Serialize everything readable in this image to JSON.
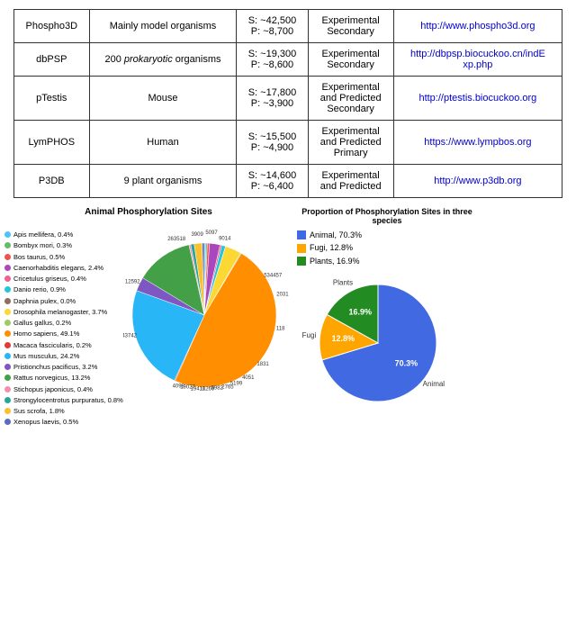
{
  "table": {
    "rows": [
      {
        "name": "Phospho3D",
        "organisms": "Mainly model organisms",
        "sites": "S: ~42,500\nP: ~8,700",
        "type": "Experimental\nSecondary",
        "url": "http://www.phospho3d.org"
      },
      {
        "name": "dbPSP",
        "organisms": "200 prokaryotic organisms",
        "organisms_italic": "prokaryotic",
        "sites": "S: ~19,300\nP: ~8,600",
        "type": "Experimental\nSecondary",
        "url": "http://dbpsp.biocuckoo.cn/indExp.php"
      },
      {
        "name": "pTestis",
        "organisms": "Mouse",
        "sites": "S: ~17,800\nP: ~3,900",
        "type": "Experimental\nand Predicted\nSecondary",
        "url": "http://ptestis.biocuckoo.org"
      },
      {
        "name": "LymPHOS",
        "organisms": "Human",
        "sites": "S: ~15,500\nP: ~4,900",
        "type": "Experimental\nand Predicted\nPrimary",
        "url": "https://www.lympbos.org"
      },
      {
        "name": "P3DB",
        "organisms": "9 plant organisms",
        "sites": "S: ~14,600\nP: ~6,400",
        "type": "Experimental\nand Predicted",
        "url": "http://www.p3db.org"
      }
    ]
  },
  "leftChart": {
    "title": "Animal Phosphorylation Sites",
    "legend": [
      {
        "label": "Apis mellifera, 0.4%",
        "color": "#1E90FF"
      },
      {
        "label": "Bombyx mori, 0.3%",
        "color": "#32CD32"
      },
      {
        "label": "Bos taurus, 0.5%",
        "color": "#FF6347"
      },
      {
        "label": "Caenorhabditis elegans, 2.4%",
        "color": "#9370DB"
      },
      {
        "label": "Cricetulus griseus, 0.4%",
        "color": "#FF1493"
      },
      {
        "label": "Danio rerio, 0.9%",
        "color": "#00CED1"
      },
      {
        "label": "Daphnia pulex, 0.0%",
        "color": "#8B4513"
      },
      {
        "label": "Drosophila melanogaster, 3.7%",
        "color": "#FFD700"
      },
      {
        "label": "Gallus gallus, 0.2%",
        "color": "#ADFF2F"
      },
      {
        "label": "Homo sapiens, 49.1%",
        "color": "#FF8C00"
      },
      {
        "label": "Macaca fascicularis, 0.2%",
        "color": "#DC143C"
      },
      {
        "label": "Mus musculus, 24.2%",
        "color": "#00BFFF"
      },
      {
        "label": "Pristionchus pacificus, 3.2%",
        "color": "#7B68EE"
      },
      {
        "label": "Rattus norvegicus, 13.2%",
        "color": "#3CB371"
      },
      {
        "label": "Stichopus japonicus, 0.4%",
        "color": "#FF69B4"
      },
      {
        "label": "Strongylocentrotus purpuratus, 0.8%",
        "color": "#20B2AA"
      },
      {
        "label": "Sus scrofa, 1.8%",
        "color": "#B8860B"
      },
      {
        "label": "Xenopus laevis, 0.5%",
        "color": "#6A5ACD"
      }
    ],
    "annotations": [
      {
        "value": "3909",
        "angle": -80
      },
      {
        "value": "5097",
        "angle": -60
      },
      {
        "value": "9014",
        "angle": -30
      },
      {
        "value": "118",
        "angle": 100
      },
      {
        "value": "1831",
        "angle": 120
      },
      {
        "value": "4051",
        "angle": 140
      },
      {
        "value": "5199",
        "angle": 150
      },
      {
        "value": "2765",
        "angle": 160
      },
      {
        "value": "9982",
        "angle": 170
      },
      {
        "value": "10269",
        "angle": 180
      },
      {
        "value": "19411",
        "angle": 190
      },
      {
        "value": "19027",
        "angle": 200
      },
      {
        "value": "4098",
        "angle": 210
      },
      {
        "value": "143742",
        "angle": 250
      },
      {
        "value": "12592",
        "angle": 300
      },
      {
        "value": "263518",
        "angle": 340
      },
      {
        "value": "534457",
        "angle": 20
      },
      {
        "value": "2031",
        "angle": 60
      }
    ]
  },
  "rightChart": {
    "title": "Proportion of Phosphorylation Sites in three species",
    "legend": [
      {
        "label": "Animal, 70.3%",
        "color": "#4169E1"
      },
      {
        "label": "Fugi, 12.8%",
        "color": "#FFA500"
      },
      {
        "label": "Plants, 16.9%",
        "color": "#228B22"
      }
    ],
    "slices": [
      {
        "label": "Animal",
        "value": 70.3,
        "color": "#4169E1"
      },
      {
        "label": "Fugi",
        "value": 12.8,
        "color": "#FFA500"
      },
      {
        "label": "Plants",
        "value": 16.9,
        "color": "#228B22"
      }
    ]
  }
}
